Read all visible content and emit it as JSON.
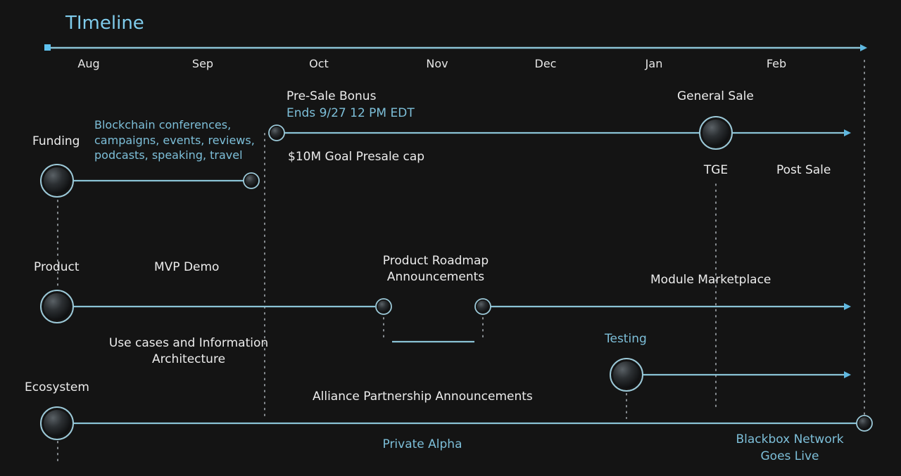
{
  "title": "TImeline",
  "colors": {
    "background": "#141414",
    "line": "#8ac3d6",
    "accent_text": "#7dbfd9",
    "arrow": "#5fb8e0",
    "dots": "#8a8f94"
  },
  "months": [
    "Aug",
    "Sep",
    "Oct",
    "Nov",
    "Dec",
    "Jan",
    "Feb"
  ],
  "tracks": {
    "funding": {
      "label": "Funding",
      "marketing_note": "Blockchain conferences,\ncampaigns, events, reviews,\npodcasts, speaking, travel",
      "presale_title": "Pre-Sale Bonus",
      "presale_ends": "Ends 9/27 12 PM EDT",
      "presale_goal": "$10M Goal Presale cap",
      "general_sale": "General Sale",
      "tge": "TGE",
      "post_sale": "Post Sale"
    },
    "product": {
      "label": "Product",
      "mvp_demo": "MVP Demo",
      "use_cases": "Use cases and Information\nArchitecture",
      "roadmap": "Product Roadmap\nAnnouncements",
      "module_marketplace": "Module Marketplace",
      "testing": "Testing"
    },
    "ecosystem": {
      "label": "Ecosystem",
      "alliance": "Alliance Partnership Announcements",
      "private_alpha": "Private Alpha",
      "network_live": "Blackbox Network\nGoes Live"
    }
  }
}
